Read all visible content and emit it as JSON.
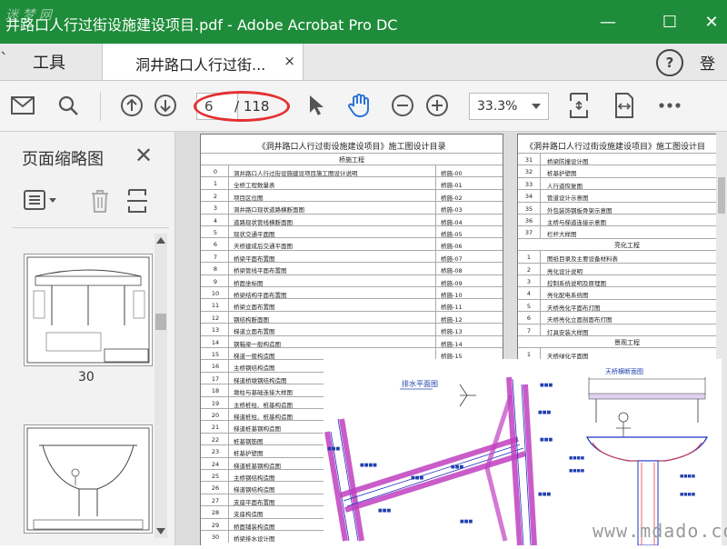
{
  "window": {
    "title": "井路口人行过街设施建设项目.pdf - Adobe Acrobat Pro DC",
    "minimize_glyph": "—",
    "maximize_glyph": "☐",
    "close_glyph": "✕"
  },
  "tabs": {
    "tools_label": "工具",
    "document_tab_label": "洞井路口人行过街...",
    "close_glyph": "×",
    "help_glyph": "?",
    "login_label": "登"
  },
  "toolbar": {
    "current_page": "6",
    "total_pages": "/ 118",
    "zoom_value": "33.3%"
  },
  "left_panel": {
    "title": "页面缩略图",
    "close_glyph": "✕",
    "thumbnail_label": "30"
  },
  "document": {
    "left_title": "《洞井路口人行过街设施建设项目》施工图设计目录",
    "left_section": "桥施工程",
    "left_rows": [
      {
        "n": "0",
        "t": "洞井路口人行过街设施建设项目施工图设计说明",
        "c": "桥施-00"
      },
      {
        "n": "1",
        "t": "全桥工程数量表",
        "c": "桥施-01"
      },
      {
        "n": "2",
        "t": "项目区位图",
        "c": "桥施-02"
      },
      {
        "n": "3",
        "t": "洞井路口现状道路横断面图",
        "c": "桥施-03"
      },
      {
        "n": "4",
        "t": "道路现状管线横断面图",
        "c": "桥施-04"
      },
      {
        "n": "5",
        "t": "现状交通平面图",
        "c": "桥施-05"
      },
      {
        "n": "6",
        "t": "天桥建成后交通平面图",
        "c": "桥施-06"
      },
      {
        "n": "7",
        "t": "桥梁平面布置图",
        "c": "桥施-07"
      },
      {
        "n": "8",
        "t": "桥梁管线平面布置图",
        "c": "桥施-08"
      },
      {
        "n": "9",
        "t": "桥面坐标图",
        "c": "桥施-09"
      },
      {
        "n": "10",
        "t": "桥梁结构平面布置图",
        "c": "桥施-10"
      },
      {
        "n": "11",
        "t": "桥梁立面布置图",
        "c": "桥施-11"
      },
      {
        "n": "12",
        "t": "钢结构断面图",
        "c": "桥施-12"
      },
      {
        "n": "13",
        "t": "梯道立面布置图",
        "c": "桥施-13"
      },
      {
        "n": "14",
        "t": "钢箱梁一般构造图",
        "c": "桥施-14"
      },
      {
        "n": "15",
        "t": "梯道一般构造图",
        "c": "桥施-15"
      },
      {
        "n": "16",
        "t": "主桥钢结构造图",
        "c": ""
      },
      {
        "n": "17",
        "t": "梯道桥墩钢结构造图",
        "c": ""
      },
      {
        "n": "18",
        "t": "墩柱与基础连接大样图",
        "c": ""
      },
      {
        "n": "19",
        "t": "主桥桩柱、桩基构造图",
        "c": ""
      },
      {
        "n": "20",
        "t": "梯道桩柱、桩基构造图",
        "c": ""
      },
      {
        "n": "21",
        "t": "梯道桩基钢构造图",
        "c": ""
      },
      {
        "n": "22",
        "t": "桩基钢筋图",
        "c": ""
      },
      {
        "n": "23",
        "t": "桩基护壁图",
        "c": ""
      },
      {
        "n": "24",
        "t": "梯道桩基钢构造图",
        "c": ""
      },
      {
        "n": "25",
        "t": "主桥钢结构造图",
        "c": ""
      },
      {
        "n": "26",
        "t": "梯道钢结构造图",
        "c": ""
      },
      {
        "n": "27",
        "t": "支座平面布置图",
        "c": ""
      },
      {
        "n": "28",
        "t": "支座构造图",
        "c": ""
      },
      {
        "n": "29",
        "t": "桥面铺装构造图",
        "c": ""
      },
      {
        "n": "30",
        "t": "桥梁排水设计图",
        "c": "桥施-30"
      }
    ],
    "right_title": "《洞井路口人行过街设施建设项目》施工图设计目",
    "right_rows_a": [
      {
        "n": "31",
        "t": "桥梁防撞设计图"
      },
      {
        "n": "32",
        "t": "桩基护壁图"
      },
      {
        "n": "33",
        "t": "人行道恢复图"
      },
      {
        "n": "34",
        "t": "管道设计示意图"
      },
      {
        "n": "35",
        "t": "外包装饰钢板骨架示意图"
      },
      {
        "n": "36",
        "t": "主桥与梯道连接示意图"
      },
      {
        "n": "37",
        "t": "栏杆大样图"
      }
    ],
    "right_section_b": "亮化工程",
    "right_rows_b": [
      {
        "n": "1",
        "t": "图纸目录及主要设备材料表"
      },
      {
        "n": "2",
        "t": "亮化设计说明"
      },
      {
        "n": "3",
        "t": "控制系统说明及原理图"
      },
      {
        "n": "4",
        "t": "亮化配电系统图"
      },
      {
        "n": "5",
        "t": "天桥亮化平面布灯图"
      },
      {
        "n": "6",
        "t": "天桥亮化立面剖面布灯图"
      },
      {
        "n": "7",
        "t": "灯具安装大样图"
      }
    ],
    "right_section_c": "景观工程",
    "right_rows_c": [
      {
        "n": "1",
        "t": "天桥绿化平面图"
      }
    ],
    "drawing_plan_title": "排水平面图",
    "drawing_section_title": "天桥横断面图"
  },
  "watermarks": {
    "top": "迷 梦 网",
    "bottom": "www.mdado.com"
  },
  "icons": [
    "mail-icon",
    "search-icon",
    "page-up-icon",
    "page-down-icon",
    "pointer-icon",
    "hand-icon",
    "zoom-out-icon",
    "zoom-in-icon",
    "fit-page-icon",
    "fit-width-icon",
    "more-icon",
    "options-icon",
    "trash-icon",
    "thumbnail-extract-icon"
  ],
  "colors": {
    "titlebar": "#1e8c3a",
    "annotation": "#e53030",
    "hand": "#2a74d6"
  }
}
